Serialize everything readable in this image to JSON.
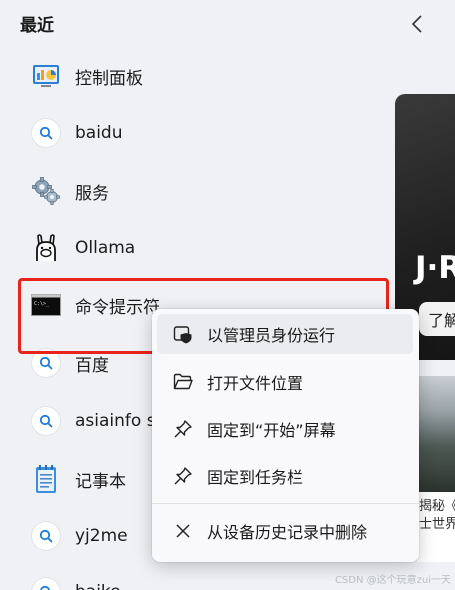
{
  "header": {
    "title": "最近"
  },
  "recent_list": [
    {
      "label": "控制面板",
      "icon": "control-panel-icon"
    },
    {
      "label": "baidu",
      "icon": "search-icon"
    },
    {
      "label": "服务",
      "icon": "services-gear-icon"
    },
    {
      "label": "Ollama",
      "icon": "ollama-llama-icon"
    },
    {
      "label": "命令提示符",
      "icon": "command-prompt-icon"
    },
    {
      "label": "百度",
      "icon": "search-icon"
    },
    {
      "label": "asiainfo s",
      "icon": "search-icon"
    },
    {
      "label": "记事本",
      "icon": "notepad-icon"
    },
    {
      "label": "yj2me",
      "icon": "search-icon"
    },
    {
      "label": "baike",
      "icon": "search-icon"
    }
  ],
  "context_menu": [
    {
      "label": "以管理员身份运行",
      "icon": "shield-run-icon"
    },
    {
      "label": "打开文件位置",
      "icon": "folder-open-icon"
    },
    {
      "label": "固定到“开始”屏幕",
      "icon": "pin-icon"
    },
    {
      "label": "固定到任务栏",
      "icon": "pin-icon"
    },
    {
      "label": "从设备历史记录中删除",
      "icon": "close-x-icon"
    }
  ],
  "preview": {
    "title": "J·R",
    "button_label": "了解",
    "caption_line1": "揭秘《",
    "caption_line2": "士世界"
  },
  "watermark": "CSDN @这个玩意zui一天",
  "colors": {
    "highlight_border": "#e8231c",
    "background": "#eff1f5",
    "menu_background": "#f9f9fb",
    "search_icon_blue": "#1e7bd6"
  }
}
